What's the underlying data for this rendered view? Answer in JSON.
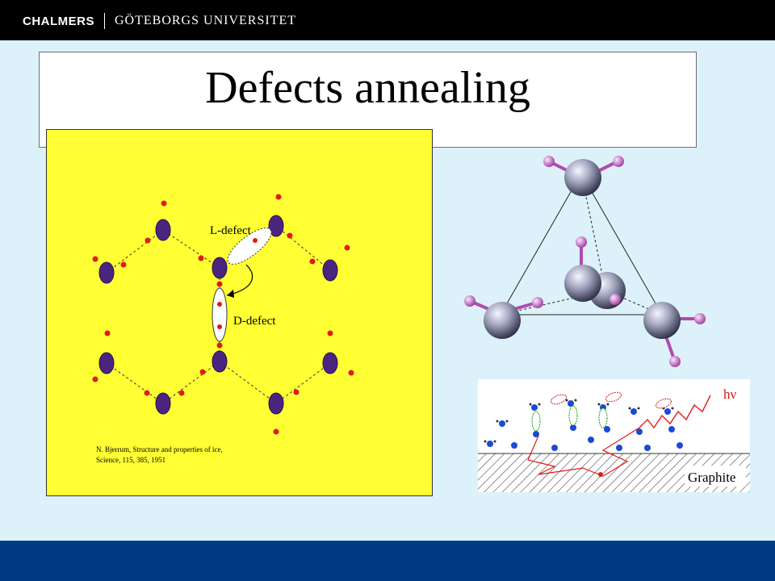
{
  "header": {
    "brand_primary": "CHALMERS",
    "brand_secondary": "GÖTEBORGS UNIVERSITET"
  },
  "slide": {
    "title": "Defects annealing"
  },
  "ice_figure": {
    "l_defect_label": "L-defect",
    "d_defect_label": "D-defect",
    "citation_line1": "N. Bjerrum, Structure and properties of ice,",
    "citation_line2": "Science, 115, 385, 1951"
  },
  "graphite_figure": {
    "photon_label": "hν",
    "substrate_label": "Graphite"
  },
  "colors": {
    "background": "#ddf1fa",
    "header_bar": "#000000",
    "footer_bar": "#003a87",
    "ice_panel": "#ffff33",
    "oxygen": "#4a2580",
    "hydrogen": "#e21a1a",
    "tetra_sphere": "#9da0b8",
    "tetra_hydrogen": "#c060c0"
  }
}
